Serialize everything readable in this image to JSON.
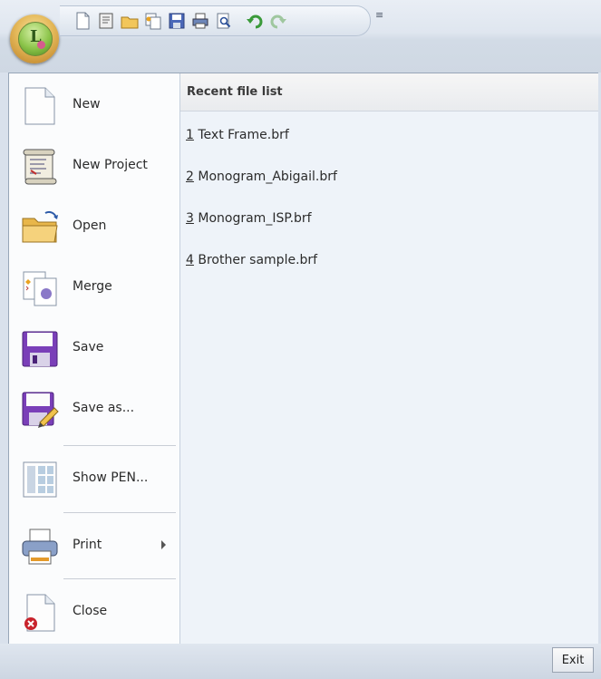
{
  "menu_items": [
    {
      "label": "New",
      "icon": "new-document-icon"
    },
    {
      "label": "New Project",
      "icon": "scroll-project-icon"
    },
    {
      "label": "Open",
      "icon": "open-folder-icon"
    },
    {
      "label": "Merge",
      "icon": "merge-icon"
    },
    {
      "label": "Save",
      "icon": "floppy-disk-icon"
    },
    {
      "label": "Save as...",
      "icon": "save-as-icon"
    },
    {
      "label": "Show PEN...",
      "icon": "show-pen-grid-icon"
    },
    {
      "label": "Print",
      "icon": "printer-icon"
    },
    {
      "label": "Close",
      "icon": "close-document-icon"
    }
  ],
  "recent": {
    "title": "Recent file list",
    "files": [
      {
        "num": "1",
        "name": " Text Frame.brf"
      },
      {
        "num": "2",
        "name": " Monogram_Abigail.brf"
      },
      {
        "num": "3",
        "name": " Monogram_ISP.brf"
      },
      {
        "num": "4",
        "name": " Brother sample.brf"
      }
    ]
  },
  "exit_label": "Exit",
  "app_button_letter": "L",
  "colors": {
    "accent": "#7a3fb8",
    "panel": "#eef3f9",
    "frame": "#d9e1ec"
  }
}
